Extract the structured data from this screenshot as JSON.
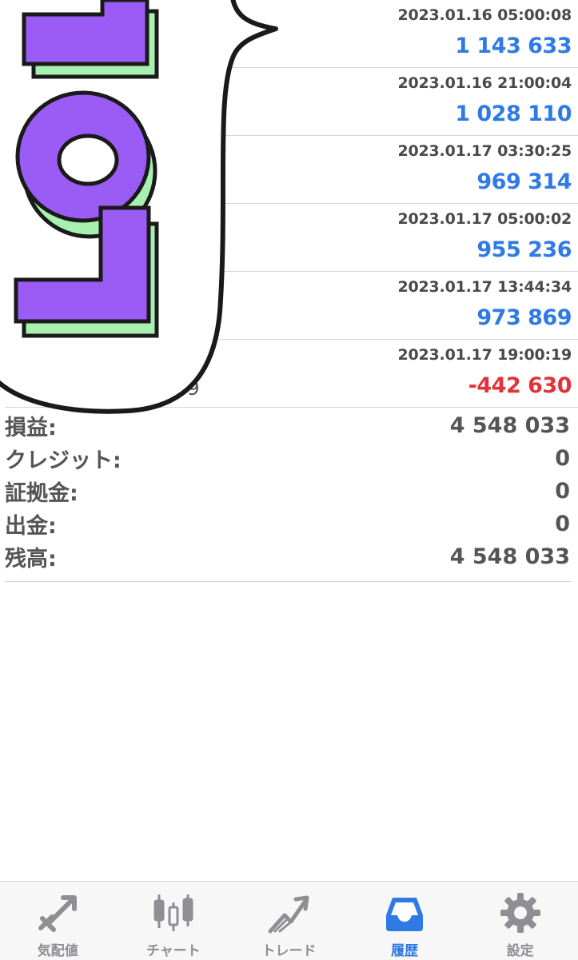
{
  "history": {
    "rows": [
      {
        "time": "2023.01.16 05:00:08",
        "profit": "1 143 633",
        "sign": "pos"
      },
      {
        "time": "2023.01.16 21:00:04",
        "profit": "1 028 110",
        "sign": "pos"
      },
      {
        "time": "2023.01.17 03:30:25",
        "profit": "969 314",
        "sign": "pos"
      },
      {
        "time": "2023.01.17 05:00:02",
        "profit": "955 236",
        "sign": "pos"
      },
      {
        "time": "2023.01.17 13:44:34",
        "profit": "973 869",
        "sign": "pos"
      },
      {
        "time": "2023.01.17 19:00:19",
        "profit": "-442 630",
        "sign": "neg",
        "partial": "979"
      }
    ]
  },
  "summary": {
    "profit_label": "損益:",
    "profit_value": "4 548 033",
    "credit_label": "クレジット:",
    "credit_value": "0",
    "margin_label": "証拠金:",
    "margin_value": "0",
    "withdrawal_label": "出金:",
    "withdrawal_value": "0",
    "balance_label": "残高:",
    "balance_value": "4 548 033"
  },
  "sticker": {
    "text": "LOL",
    "fill": "#9b5cf6",
    "shadow": "#a8f0b0"
  },
  "tabs": {
    "quotes": "気配値",
    "chart": "チャート",
    "trade": "トレード",
    "history": "履歴",
    "settings": "設定"
  },
  "colors": {
    "accent": "#2f7ae5",
    "positive": "#2f7ae5",
    "negative": "#e0333a"
  }
}
